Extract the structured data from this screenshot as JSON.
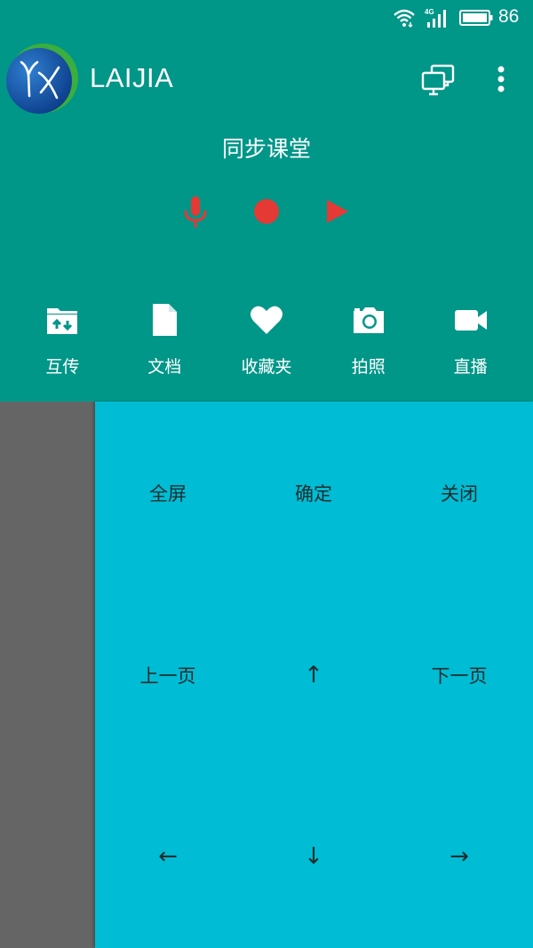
{
  "status_bar": {
    "network": "4G",
    "battery": "86"
  },
  "app_bar": {
    "title": "LAIJIA",
    "logo_text": "YX",
    "icons": [
      "cast-screen-icon",
      "more-vert-icon"
    ]
  },
  "session": {
    "title": "同步课堂",
    "controls": [
      {
        "name": "microphone",
        "icon": "microphone-icon"
      },
      {
        "name": "record",
        "icon": "record-icon"
      },
      {
        "name": "play",
        "icon": "play-icon"
      }
    ],
    "control_color": "#e53935"
  },
  "tools": [
    {
      "label": "互传",
      "icon": "folder-transfer-icon"
    },
    {
      "label": "文档",
      "icon": "document-icon"
    },
    {
      "label": "收藏夹",
      "icon": "heart-icon"
    },
    {
      "label": "拍照",
      "icon": "camera-icon"
    },
    {
      "label": "直播",
      "icon": "video-camera-icon"
    }
  ],
  "remote": {
    "keys": [
      [
        "全屏",
        "确定",
        "关闭"
      ],
      [
        "上一页",
        "↑",
        "下一页"
      ],
      [
        "←",
        "↓",
        "→"
      ]
    ]
  },
  "colors": {
    "primary": "#009688",
    "remote_bg": "#00bcd4",
    "side_panel": "#656565"
  }
}
